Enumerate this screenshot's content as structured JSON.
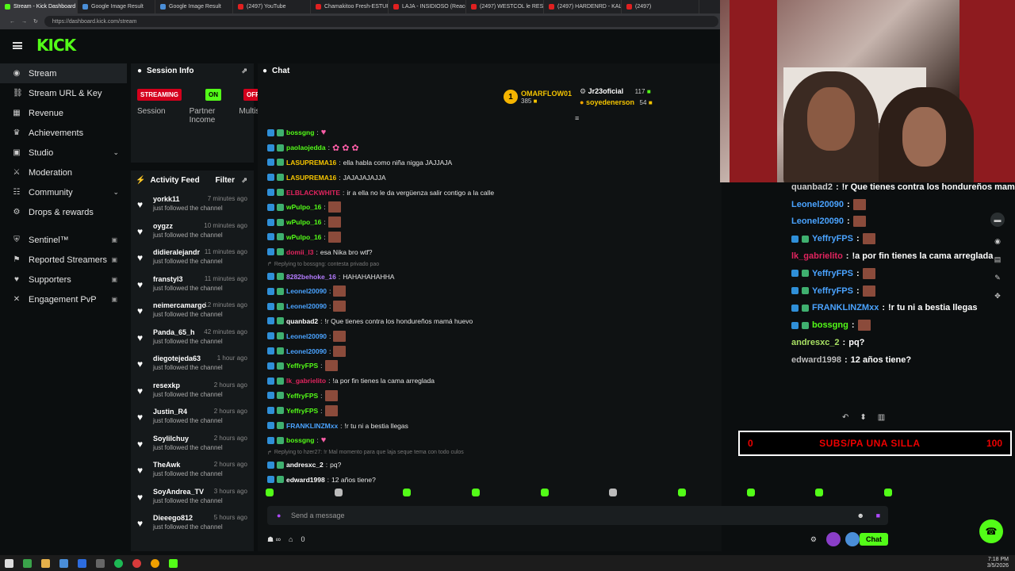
{
  "browser": {
    "tabs": [
      "Stream - Kick Dashboard",
      "Google Image Result",
      "Google Image Result",
      "(2497) YouTube",
      "Chamakitoo Fresh-ESTUPI",
      "LAJA - INSIDIOSO (Reacci",
      "(2497) WESTCOL le RESPO",
      "(2497) HARDENRD - KALV",
      "(2497)"
    ],
    "url": "https://dashboard.kick.com/stream"
  },
  "brand": {
    "logo": "KICK",
    "accent": "#53fc18"
  },
  "sidebar": {
    "items": [
      {
        "label": "Stream",
        "icon": "broadcast-icon",
        "active": true
      },
      {
        "label": "Stream URL & Key",
        "icon": "link-icon"
      },
      {
        "label": "Revenue",
        "icon": "revenue-icon"
      },
      {
        "label": "Achievements",
        "icon": "trophy-icon"
      },
      {
        "label": "Studio",
        "icon": "studio-icon",
        "chevron": true
      },
      {
        "label": "Moderation",
        "icon": "sword-icon"
      },
      {
        "label": "Community",
        "icon": "community-icon",
        "chevron": true
      },
      {
        "label": "Drops & rewards",
        "icon": "gift-icon"
      }
    ],
    "locked": [
      {
        "label": "Sentinel™",
        "icon": "shield-icon"
      },
      {
        "label": "Reported Streamers",
        "icon": "flag-icon"
      },
      {
        "label": "Supporters",
        "icon": "heart-icon"
      },
      {
        "label": "Engagement PvP",
        "icon": "pvp-icon"
      }
    ]
  },
  "session": {
    "title": "Session Info",
    "badges": [
      "STREAMING",
      "ON",
      "OFF"
    ],
    "labels": [
      "Session",
      "Partner Income",
      "Multis"
    ]
  },
  "activity": {
    "title": "Activity Feed",
    "filter": "Filter",
    "followed": "just followed the channel",
    "rows": [
      {
        "name": "yorkk11",
        "time": "7 minutes ago"
      },
      {
        "name": "oygzz",
        "time": "10 minutes ago"
      },
      {
        "name": "didieralejandr",
        "time": "11 minutes ago"
      },
      {
        "name": "franstyl3",
        "time": "11 minutes ago"
      },
      {
        "name": "neimercamargo",
        "time": "12 minutes ago"
      },
      {
        "name": "Panda_65_h",
        "time": "42 minutes ago"
      },
      {
        "name": "diegotejeda63",
        "time": "1 hour ago"
      },
      {
        "name": "resexkp",
        "time": "2 hours ago"
      },
      {
        "name": "Justin_R4",
        "time": "2 hours ago"
      },
      {
        "name": "Soylilchuy",
        "time": "2 hours ago"
      },
      {
        "name": "TheAwk",
        "time": "2 hours ago"
      },
      {
        "name": "SoyAndrea_TV",
        "time": "3 hours ago"
      },
      {
        "name": "Dieeego812",
        "time": "5 hours ago"
      }
    ]
  },
  "chat": {
    "title": "Chat",
    "leaders": {
      "first": {
        "rank": "1",
        "name": "OMARFLOW01",
        "count": "385"
      },
      "second": {
        "name": "Jr23oficial",
        "count": "117"
      },
      "third": {
        "name": "soyedenerson",
        "count": "54"
      }
    },
    "messages": [
      {
        "user": "bossgng",
        "color": "#53fc18",
        "text": "",
        "emote": "heart"
      },
      {
        "user": "paolaojedda",
        "color": "#53fc18",
        "text": "",
        "emote": "triple"
      },
      {
        "user": "LASUPREMA16",
        "color": "#f5c400",
        "text": "ella habla como niña nigga JAJJAJA"
      },
      {
        "user": "LASUPREMA16",
        "color": "#f5c400",
        "text": "JAJAJAJAJJA"
      },
      {
        "user": "ELBLACKWHITE",
        "color": "#e0245e",
        "text": "ir a ella no le da vergüenza salir contigo a la calle"
      },
      {
        "user": "wPulpo_16",
        "color": "#53fc18",
        "text": "",
        "emote": "pic"
      },
      {
        "user": "wPulpo_16",
        "color": "#53fc18",
        "text": "",
        "emote": "pic"
      },
      {
        "user": "wPulpo_16",
        "color": "#53fc18",
        "text": "",
        "emote": "pic"
      },
      {
        "user": "domii_l3",
        "color": "#e0245e",
        "text": "esa Nika bro wtf?"
      },
      {
        "reply": "Replying to bossgng: contesta privado pao"
      },
      {
        "user": "8282behoke_16",
        "color": "#b47cff",
        "text": "HAHAHAHAHHA"
      },
      {
        "user": "Leonel20090",
        "color": "#4aa3ff",
        "text": "",
        "emote": "pic"
      },
      {
        "user": "Leonel20090",
        "color": "#4aa3ff",
        "text": "",
        "emote": "pic"
      },
      {
        "user": "quanbad2",
        "color": "#ffffff",
        "text": "!r Que tienes contra los hondureños mamá huevo"
      },
      {
        "user": "Leonel20090",
        "color": "#4aa3ff",
        "text": "",
        "emote": "pic"
      },
      {
        "user": "Leonel20090",
        "color": "#4aa3ff",
        "text": "",
        "emote": "pic"
      },
      {
        "user": "YeffryFPS",
        "color": "#53fc18",
        "text": "",
        "emote": "pic"
      },
      {
        "user": "lk_gabrielito",
        "color": "#e0245e",
        "text": "!a por fin tienes la cama arreglada"
      },
      {
        "user": "YeffryFPS",
        "color": "#53fc18",
        "text": "",
        "emote": "pic"
      },
      {
        "user": "YeffryFPS",
        "color": "#53fc18",
        "text": "",
        "emote": "pic"
      },
      {
        "user": "FRANKLINZMxx",
        "color": "#4aa3ff",
        "text": "!r tu ni a bestia llegas"
      },
      {
        "user": "bossgng",
        "color": "#53fc18",
        "text": "",
        "emote": "heart"
      },
      {
        "reply": "Replying to hzer27: !r Mal momento para que laja seque tema con todo culos"
      },
      {
        "user": "andresxc_2",
        "color": "#ffffff",
        "text": "pq?"
      },
      {
        "user": "edward1998",
        "color": "#ffffff",
        "text": "12 años tiene?"
      }
    ],
    "input_placeholder": "Send a message",
    "points": "0",
    "chat_button": "Chat"
  },
  "overlay": {
    "messages": [
      {
        "user": "quanbad2",
        "color": "#cccccc",
        "text": "!r Que tienes contra los hondureños mamá"
      },
      {
        "user": "Leonel20090",
        "color": "#4aa3ff",
        "text": "",
        "emote": true
      },
      {
        "user": "Leonel20090",
        "color": "#4aa3ff",
        "text": "",
        "emote": true
      },
      {
        "user": "YeffryFPS",
        "color": "#4aa3ff",
        "text": "",
        "emote": true,
        "badges": true
      },
      {
        "user": "lk_gabrielito",
        "color": "#e0245e",
        "text": "!a por fin tienes la cama arreglada"
      },
      {
        "user": "YeffryFPS",
        "color": "#4aa3ff",
        "text": "",
        "emote": true,
        "badges": true
      },
      {
        "user": "YeffryFPS",
        "color": "#4aa3ff",
        "text": "",
        "emote": true,
        "badges": true
      },
      {
        "user": "FRANKLINZMxx",
        "color": "#4aa3ff",
        "text": "!r tu ni a bestia llegas",
        "badges": true
      },
      {
        "user": "bossgng",
        "color": "#53fc18",
        "text": "",
        "emote": true,
        "badges": true
      },
      {
        "user": "andresxc_2",
        "color": "#a8e063",
        "text": "pq?"
      },
      {
        "user": "edward1998",
        "color": "#bbbbbb",
        "text": "12 años tiene?"
      }
    ],
    "goal": {
      "start": "0",
      "label": "SUBS/PA UNA SILLA",
      "end": "100"
    }
  },
  "taskbar": {
    "time": "7:18 PM",
    "date": "3/5/2026"
  }
}
